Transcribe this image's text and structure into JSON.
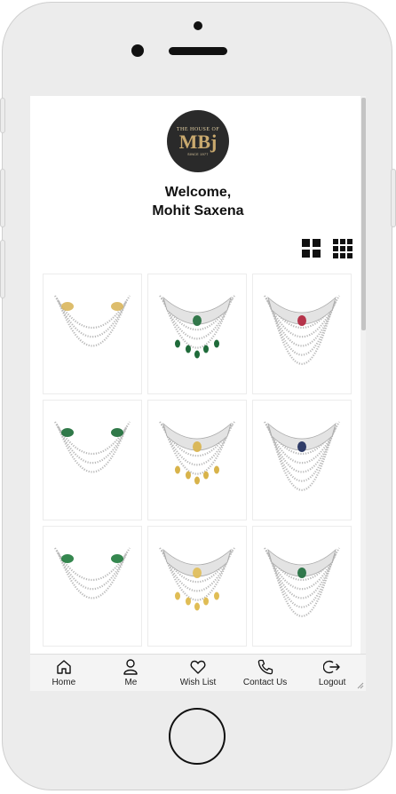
{
  "brand": {
    "logo_top": "THE HOUSE OF",
    "logo_mark": "MBj",
    "logo_bottom": "SINCE 1977"
  },
  "welcome": {
    "line1": "Welcome,",
    "line2": "Mohit Saxena"
  },
  "view_toggles": [
    "grid-large-icon",
    "grid-small-icon"
  ],
  "products": [
    {
      "name": "necklace-1",
      "stone_color": "#d9b65c"
    },
    {
      "name": "necklace-2",
      "stone_color": "#1f6b3a"
    },
    {
      "name": "necklace-3",
      "stone_color": "#b0203a"
    },
    {
      "name": "necklace-4",
      "stone_color": "#1a6a35"
    },
    {
      "name": "necklace-5",
      "stone_color": "#d8b34a"
    },
    {
      "name": "necklace-6",
      "stone_color": "#1c2a5a"
    },
    {
      "name": "necklace-7",
      "stone_color": "#1f7a3c"
    },
    {
      "name": "necklace-8",
      "stone_color": "#e0bd55"
    },
    {
      "name": "necklace-9",
      "stone_color": "#1d6b3b"
    }
  ],
  "tabbar": {
    "items": [
      {
        "label": "Home",
        "icon": "home-icon"
      },
      {
        "label": "Me",
        "icon": "user-icon"
      },
      {
        "label": "Wish List",
        "icon": "heart-icon"
      },
      {
        "label": "Contact Us",
        "icon": "phone-icon"
      },
      {
        "label": "Logout",
        "icon": "logout-icon"
      }
    ]
  },
  "colors": {
    "frame": "#ececec",
    "logo_bg": "#2a2a2a",
    "logo_gold": "#c9a96e",
    "tabbar_bg": "#f4f4f4"
  }
}
